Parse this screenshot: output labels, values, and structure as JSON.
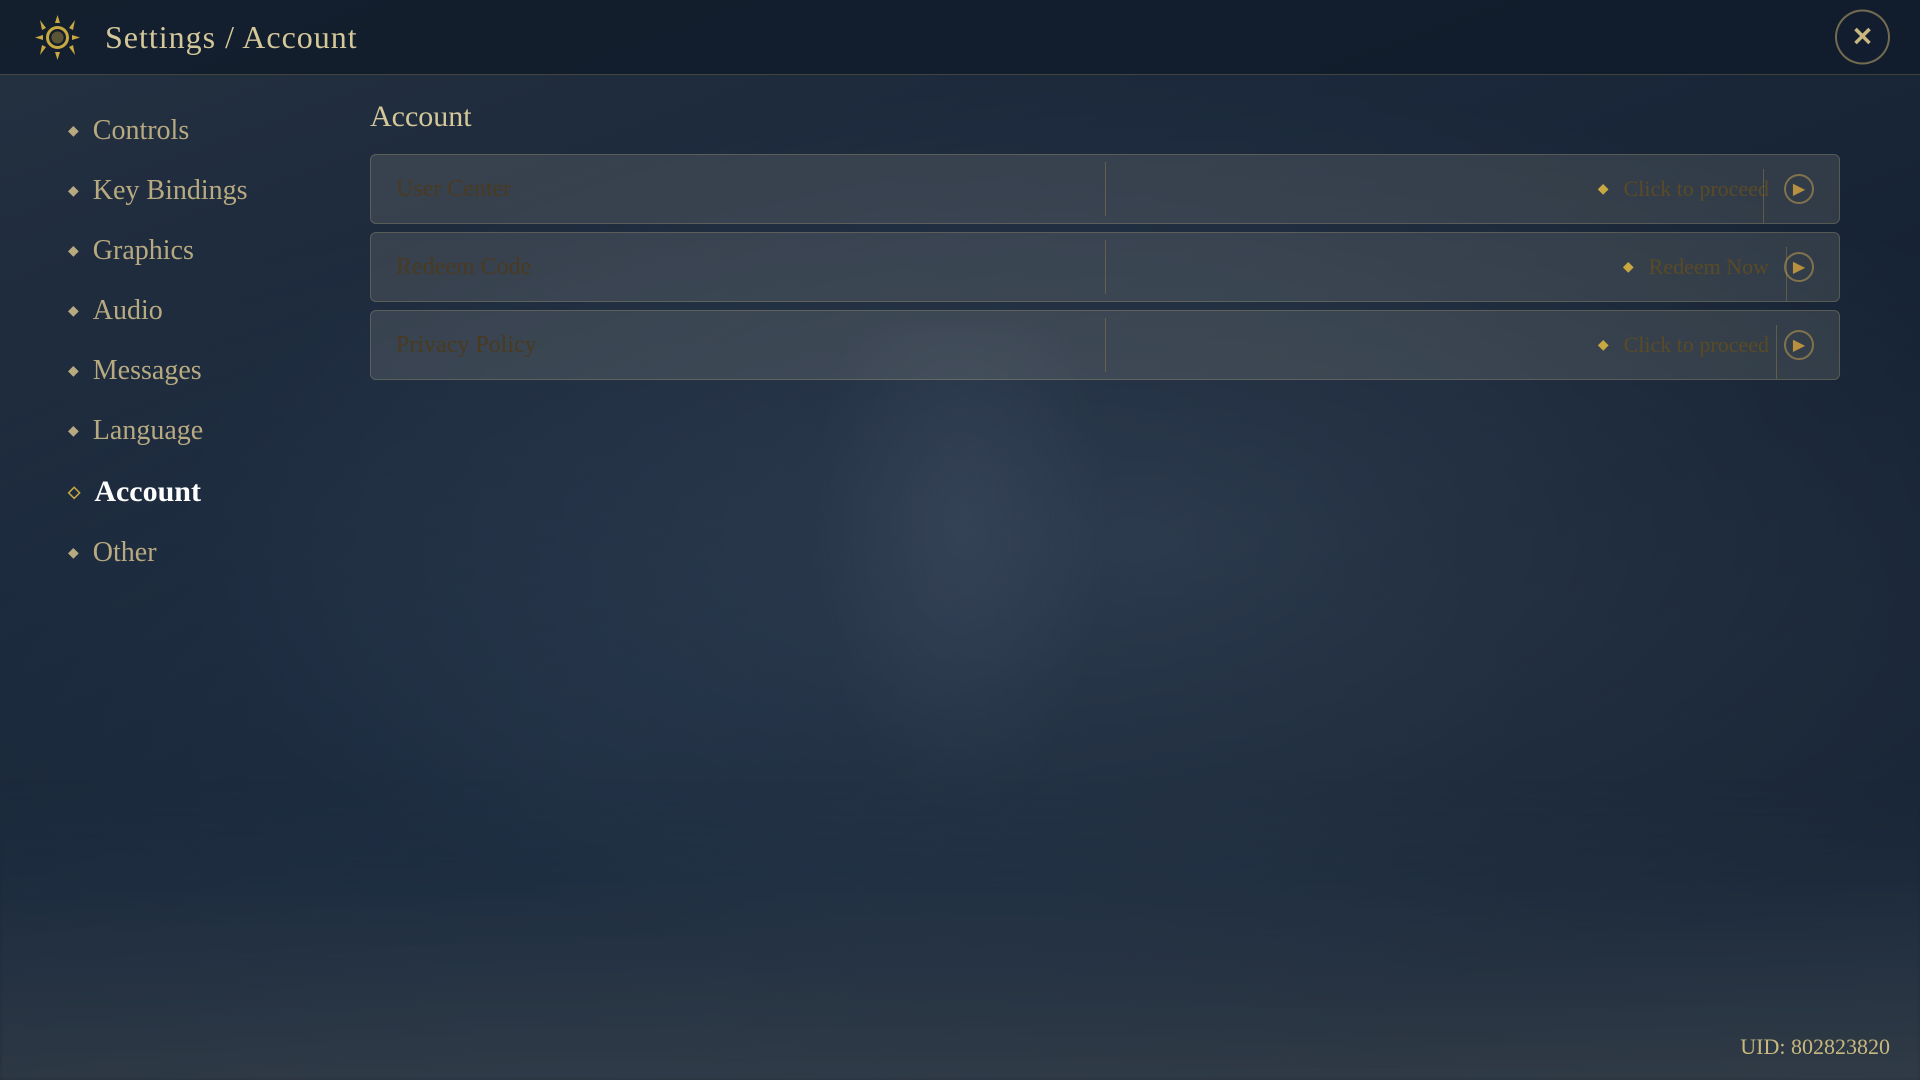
{
  "header": {
    "title": "Settings / Account",
    "close_label": "✕",
    "icon_name": "settings-gear-icon"
  },
  "sidebar": {
    "items": [
      {
        "id": "controls",
        "label": "Controls",
        "active": false,
        "bullet": "◆"
      },
      {
        "id": "key-bindings",
        "label": "Key Bindings",
        "active": false,
        "bullet": "◆"
      },
      {
        "id": "graphics",
        "label": "Graphics",
        "active": false,
        "bullet": "◆"
      },
      {
        "id": "audio",
        "label": "Audio",
        "active": false,
        "bullet": "◆"
      },
      {
        "id": "messages",
        "label": "Messages",
        "active": false,
        "bullet": "◆"
      },
      {
        "id": "language",
        "label": "Language",
        "active": false,
        "bullet": "◆"
      },
      {
        "id": "account",
        "label": "Account",
        "active": true,
        "bullet": "◇"
      },
      {
        "id": "other",
        "label": "Other",
        "active": false,
        "bullet": "◆"
      }
    ]
  },
  "main": {
    "section_title": "Account",
    "rows": [
      {
        "id": "user-center",
        "left_label": "User Center",
        "right_label": "Click to proceed",
        "arrow": "▶"
      },
      {
        "id": "redeem-code",
        "left_label": "Redeem Code",
        "right_label": "Redeem Now",
        "arrow": "▶"
      },
      {
        "id": "privacy-policy",
        "left_label": "Privacy Policy",
        "right_label": "Click to proceed",
        "arrow": "▶"
      }
    ]
  },
  "footer": {
    "uid_label": "UID: 802823820"
  }
}
